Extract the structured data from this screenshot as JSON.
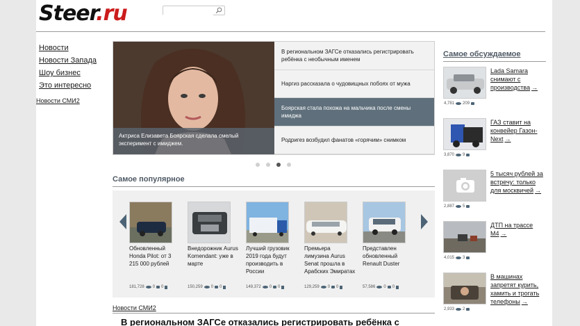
{
  "header": {
    "logo_main": "Steer",
    "logo_tld": ".ru",
    "search_placeholder": ""
  },
  "left_nav": {
    "items": [
      {
        "label": "Новости"
      },
      {
        "label": "Новости Запада"
      },
      {
        "label": "Шоу бизнес"
      },
      {
        "label": "Это интересно"
      }
    ],
    "smi2_label": "Новости СМИ2"
  },
  "slider": {
    "caption": "Актриса Елизавета Боярская сделала смелый эксперимент с имиджем.",
    "items": [
      {
        "title": "В региональном ЗАГСе отказались регистрировать ребёнка с необычным именем"
      },
      {
        "title": "Наргиз рассказала о чудовищных побоях от мужа"
      },
      {
        "title": "Боярская стала похожа на мальчика после смены имиджа"
      },
      {
        "title": "Родригез возбудил фанатов «горячим» снимком"
      }
    ],
    "active_index": 2,
    "dots": 4,
    "active_dot": 2
  },
  "popular": {
    "title": "Самое популярное",
    "cards": [
      {
        "title": "Обновленный Honda Pilot: от 3 215 000 рублей",
        "views": "181,728",
        "comments": "0",
        "likes": "0"
      },
      {
        "title": "Внедорожник Aurus Komendant: уже в марте",
        "views": "150,259",
        "comments": "0",
        "likes": "0"
      },
      {
        "title": "Лучший грузовик 2019 года будут производить в России",
        "views": "149,372",
        "comments": "0",
        "likes": "0"
      },
      {
        "title": "Премьера лимузина Aurus Senat прошла в Арабских Эмиратах",
        "views": "129,259",
        "comments": "0",
        "likes": "0"
      },
      {
        "title": "Представлен обновленный Renault Duster",
        "views": "57,586",
        "comments": "0",
        "likes": "0"
      }
    ]
  },
  "bottom": {
    "smi2_label": "Новости СМИ2",
    "headline": "В региональном ЗАГСе отказались регистрировать ребёнка с"
  },
  "discussed": {
    "title": "Самое обсуждаемое",
    "items": [
      {
        "title": "Lada Samara снимают с производства",
        "views": "4,781",
        "comments": "209"
      },
      {
        "title": "ГАЗ ставит на конвейер Газон-Next",
        "views": "3,870",
        "comments": "9"
      },
      {
        "title": "5 тысяч рублей за встречу: только для москвичей",
        "views": "2,887",
        "comments": "5"
      },
      {
        "title": "ДТП на трассе М4",
        "views": "4,015",
        "comments": "3"
      },
      {
        "title": "В машинах запретят курить, хамить и трогать телефоны",
        "views": "2,933",
        "comments": "2"
      }
    ]
  },
  "colors": {
    "accent": "#cc1b1b",
    "section_title": "#4e5964",
    "active_slide": "#5f707c",
    "arrow": "#4c6476"
  }
}
